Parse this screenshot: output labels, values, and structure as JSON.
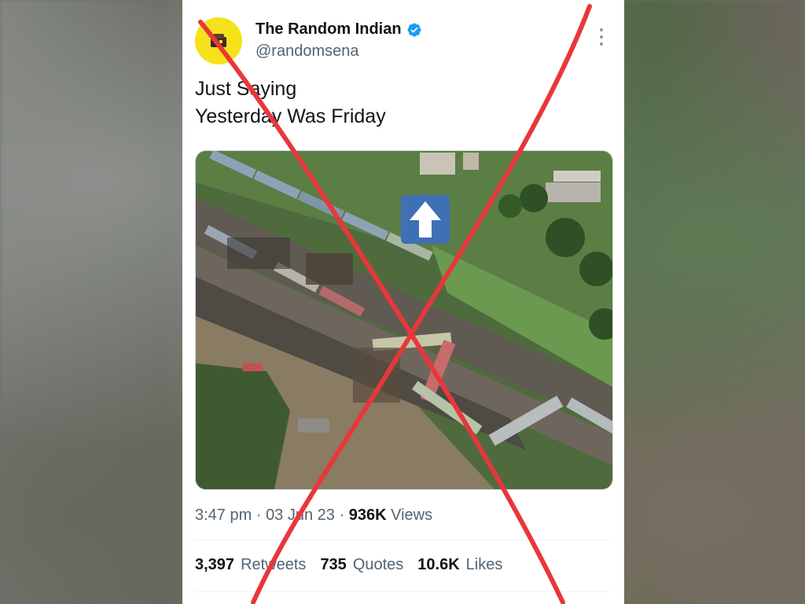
{
  "tweet": {
    "display_name": "The Random Indian",
    "handle": "@randomsena",
    "text_line1": "Just Saying",
    "text_line2": "Yesterday Was Friday",
    "time": "3:47 pm",
    "separator": "·",
    "date": "03 Jun 23",
    "views_count": "936K",
    "views_label": "Views",
    "retweets_count": "3,397",
    "retweets_label": "Retweets",
    "quotes_count": "735",
    "quotes_label": "Quotes",
    "likes_count": "10.6K",
    "likes_label": "Likes"
  },
  "icons": {
    "verified": "verified-badge-icon",
    "more": "more-options-icon",
    "up_arrow": "up-arrow-icon",
    "avatar": "avatar-logo-icon"
  },
  "colors": {
    "avatar_bg": "#f5e21b",
    "verified_blue": "#1d9bf0",
    "cross_red": "#e8373b",
    "muted_text": "#536471",
    "main_text": "#0f1419"
  }
}
